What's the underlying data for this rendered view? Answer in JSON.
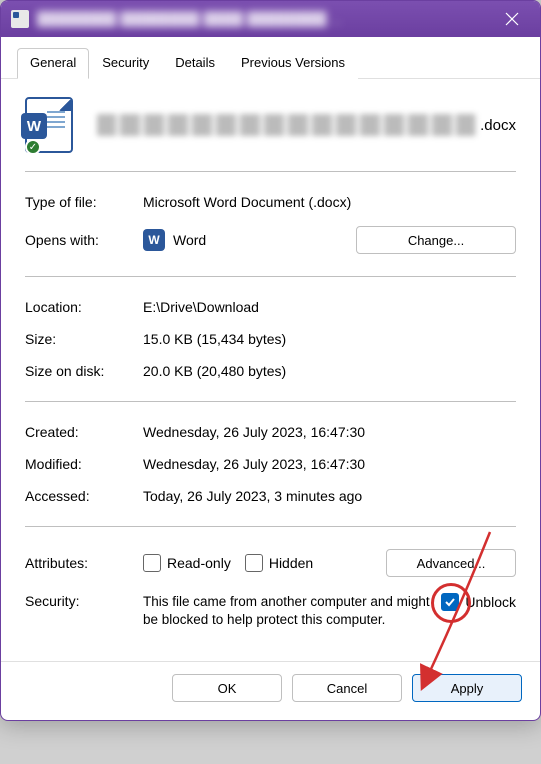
{
  "titlebar": {
    "title": "████████ ████████ ████ ████████ ..."
  },
  "tabs": {
    "general": "General",
    "security": "Security",
    "details": "Details",
    "previous": "Previous Versions"
  },
  "file": {
    "extension": ".docx"
  },
  "fields": {
    "type_label": "Type of file:",
    "type_value": "Microsoft Word Document (.docx)",
    "opens_label": "Opens with:",
    "opens_app": "Word",
    "change_btn": "Change...",
    "location_label": "Location:",
    "location_value": "E:\\Drive\\Download",
    "size_label": "Size:",
    "size_value": "15.0 KB (15,434 bytes)",
    "disk_label": "Size on disk:",
    "disk_value": "20.0 KB (20,480 bytes)",
    "created_label": "Created:",
    "created_value": "Wednesday, 26 July 2023, 16:47:30",
    "modified_label": "Modified:",
    "modified_value": "Wednesday, 26 July 2023, 16:47:30",
    "accessed_label": "Accessed:",
    "accessed_value": "Today, 26 July 2023, 3 minutes ago",
    "attributes_label": "Attributes:",
    "readonly": "Read-only",
    "hidden": "Hidden",
    "advanced_btn": "Advanced...",
    "security_label": "Security:",
    "security_msg": "This file came from another computer and might be blocked to help protect this computer.",
    "unblock": "Unblock"
  },
  "footer": {
    "ok": "OK",
    "cancel": "Cancel",
    "apply": "Apply"
  }
}
